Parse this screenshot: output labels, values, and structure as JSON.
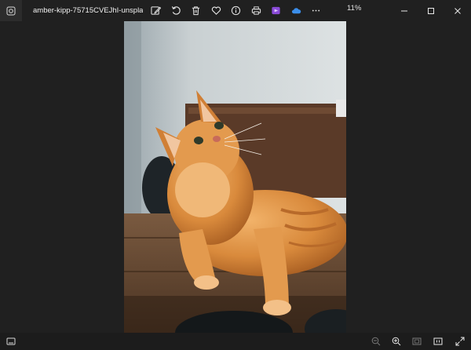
{
  "window": {
    "filename": "amber-kipp-75715CVEJhI-unsplash...",
    "app_icon": "photos-app-icon"
  },
  "toolbar": {
    "items": [
      {
        "icon": "edit-image-icon"
      },
      {
        "icon": "rotate-icon"
      },
      {
        "icon": "delete-icon"
      },
      {
        "icon": "favorite-heart-icon"
      },
      {
        "icon": "info-icon"
      },
      {
        "icon": "print-icon"
      },
      {
        "icon": "clipchamp-icon"
      },
      {
        "icon": "onedrive-cloud-icon"
      },
      {
        "icon": "more-options-icon"
      }
    ],
    "accent_purple": "#8a4bd8",
    "accent_blue": "#3b8eea"
  },
  "window_controls": [
    "minimize",
    "maximize",
    "close"
  ],
  "photo": {
    "subject": "cat-photo"
  },
  "statusbar": {
    "zoom": "11%",
    "icons": [
      "filmstrip-icon",
      "zoom-out-icon",
      "zoom-in-icon",
      "fit-to-window-icon",
      "actual-size-icon",
      "fullscreen-icon"
    ]
  }
}
